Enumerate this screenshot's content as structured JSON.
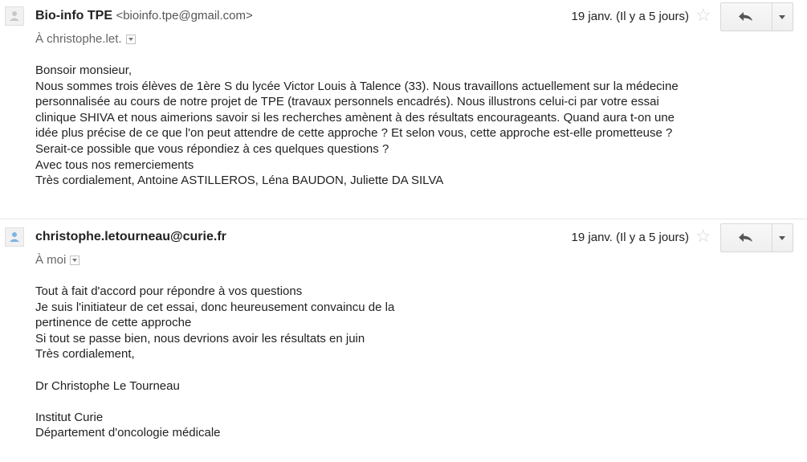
{
  "messages": [
    {
      "sender_name": "Bio-info TPE",
      "sender_email": "<bioinfo.tpe@gmail.com>",
      "to": "À christophe.let.",
      "date": "19 janv. (Il y a 5 jours)",
      "body": [
        "Bonsoir monsieur,",
        "Nous sommes trois élèves de 1ère S du lycée Victor Louis à Talence (33). Nous travaillons actuellement sur la médecine",
        "personnalisée au cours de notre projet de TPE (travaux personnels encadrés). Nous illustrons celui-ci par votre essai",
        "clinique SHIVA et nous aimerions savoir si les recherches amènent à des résultats encourageants. Quand aura t-on une",
        "idée plus précise de ce que l'on peut attendre de cette approche ? Et selon vous, cette approche est-elle prometteuse ?",
        "Serait-ce possible que vous répondiez à ces quelques questions ?",
        "Avec tous nos remerciements",
        "Très cordialement, Antoine ASTILLEROS, Léna BAUDON, Juliette DA SILVA"
      ]
    },
    {
      "sender_name": "christophe.letourneau@curie.fr",
      "sender_email": "",
      "to": "À moi",
      "date": "19 janv. (Il y a 5 jours)",
      "body": [
        "Tout à fait d'accord pour répondre à vos questions",
        "Je suis l'initiateur de cet essai, donc heureusement convaincu de la",
        "pertinence de cette approche",
        "Si tout se passe bien, nous devrions avoir les résultats en juin",
        "Très cordialement,",
        "",
        "Dr Christophe Le Tourneau",
        "",
        "Institut Curie",
        "Département d'oncologie médicale"
      ]
    }
  ],
  "icons": {
    "avatar": "person-icon",
    "star": "star-icon",
    "reply": "reply-icon",
    "more": "chevron-down-icon"
  }
}
